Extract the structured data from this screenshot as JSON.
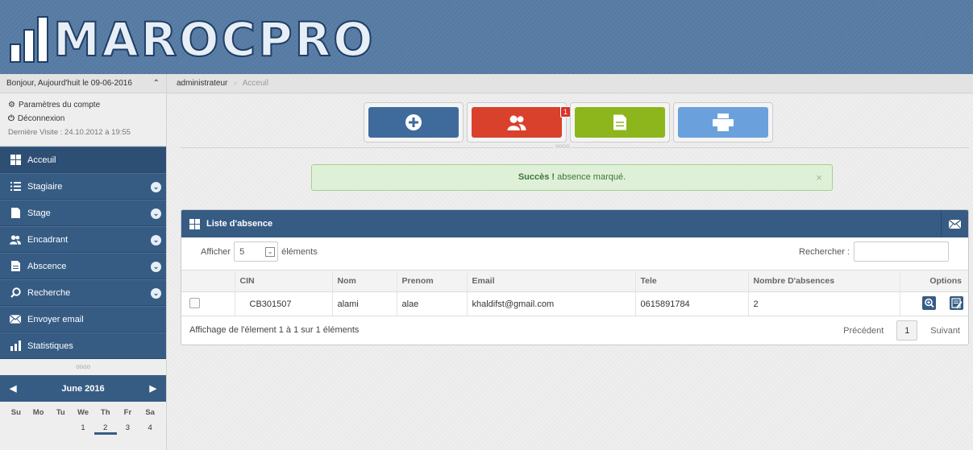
{
  "header": {
    "logo_text": "MAROCPRO"
  },
  "sidebar": {
    "greeting": "Bonjour, Aujourd'huit le 09-06-2016",
    "account_settings": "Paramètres du compte",
    "logout": "Déconnexion",
    "last_visit": "Dernière Visite : 24.10.2012 à 19:55",
    "items": [
      {
        "label": "Acceuil",
        "icon": "grid-icon"
      },
      {
        "label": "Stagiaire",
        "icon": "list-icon"
      },
      {
        "label": "Stage",
        "icon": "file-icon"
      },
      {
        "label": "Encadrant",
        "icon": "users-icon"
      },
      {
        "label": "Abscence",
        "icon": "document-icon"
      },
      {
        "label": "Recherche",
        "icon": "search-icon"
      },
      {
        "label": "Envoyer email",
        "icon": "mail-icon"
      },
      {
        "label": "Statistiques",
        "icon": "bar-chart-icon"
      }
    ],
    "divider": "oooo",
    "calendar": {
      "month": "June 2016",
      "weekdays": [
        "Su",
        "Mo",
        "Tu",
        "We",
        "Th",
        "Fr",
        "Sa"
      ],
      "days": [
        "",
        "",
        "",
        "1",
        "2",
        "3",
        "4"
      ]
    }
  },
  "breadcrumb": {
    "root": "administrateur",
    "current": "Acceuil"
  },
  "quick_actions": {
    "badge": "1",
    "divider": "oooo"
  },
  "alert": {
    "strong": "Succès !",
    "text": " absence marqué.",
    "close": "×"
  },
  "panel": {
    "title": "Liste d'absence",
    "show_label": "Afficher",
    "show_value": "5",
    "entries_label": "éléments",
    "search_label": "Rechercher :",
    "columns": [
      "",
      "CIN",
      "Nom",
      "Prenom",
      "Email",
      "Tele",
      "Nombre D'absences",
      "Options"
    ],
    "rows": [
      {
        "cin": "CB301507",
        "nom": "alami",
        "prenom": "alae",
        "email": "khaldifst@gmail.com",
        "tele": "0615891784",
        "absences": "2"
      }
    ],
    "info": "Affichage de l'élement 1 à 1 sur 1 éléments",
    "prev": "Précédent",
    "page": "1",
    "next": "Suivant"
  },
  "colors": {
    "nav_blue": "#365c84",
    "btn_add": "#3f6b9c",
    "btn_users": "#d9412c",
    "btn_doc": "#8db51c",
    "btn_print": "#6aa1dc",
    "alert_bg": "#dff0d8"
  }
}
